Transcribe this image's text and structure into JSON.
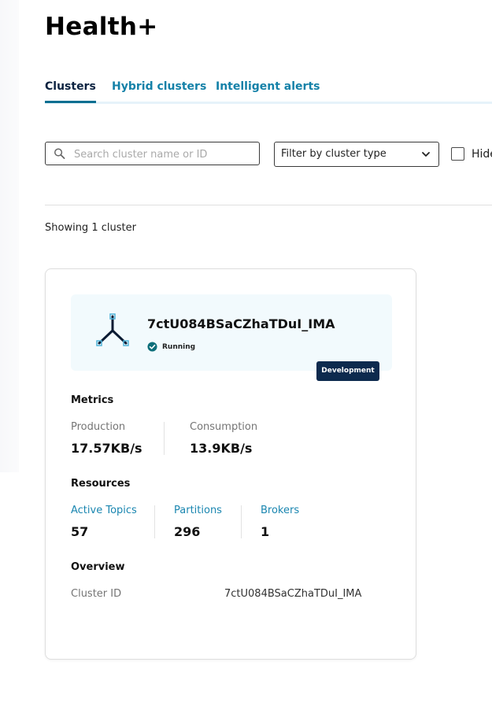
{
  "page": {
    "title": "Health+"
  },
  "tabs": [
    {
      "label": "Clusters",
      "active": true
    },
    {
      "label": "Hybrid clusters",
      "active": false
    },
    {
      "label": "Intelligent alerts",
      "active": false
    }
  ],
  "filters": {
    "search_placeholder": "Search cluster name or ID",
    "search_value": "",
    "cluster_type_selected": "Filter by cluster type",
    "hide_checkbox_label": "Hide",
    "hide_checked": false
  },
  "results": {
    "showing_text": "Showing 1 cluster"
  },
  "cluster_card": {
    "name": "7ctU084BSaCZhaTDuI_IMA",
    "status": "Running",
    "environment_badge": "Development",
    "metrics_title": "Metrics",
    "metrics": [
      {
        "label": "Production",
        "value": "17.57KB/s"
      },
      {
        "label": "Consumption",
        "value": "13.9KB/s"
      }
    ],
    "resources_title": "Resources",
    "resources": [
      {
        "label": "Active Topics",
        "value": "57"
      },
      {
        "label": "Partitions",
        "value": "296"
      },
      {
        "label": "Brokers",
        "value": "1"
      }
    ],
    "overview_title": "Overview",
    "overview": {
      "label": "Cluster ID",
      "value": "7ctU084BSaCZhaTDuI_IMA"
    }
  },
  "icons": {
    "search": "search-icon",
    "chevron": "chevron-down-icon",
    "cluster": "cluster-network-icon",
    "status": "check-circle-icon"
  },
  "colors": {
    "tab_link": "#1481a8",
    "tab_active_underline": "#0b6f91",
    "status_ok": "#0d6e7a",
    "badge_bg": "#0d2a4e",
    "card_header_bg": "#f2fafd"
  }
}
